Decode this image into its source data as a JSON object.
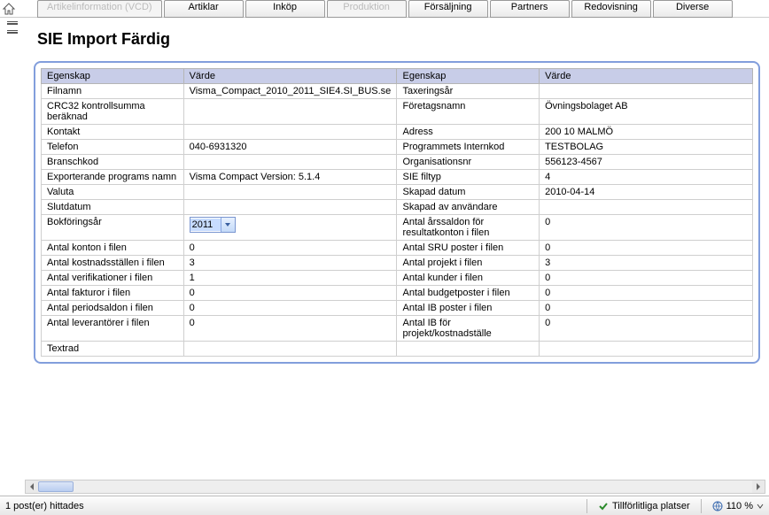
{
  "tabs": {
    "items": [
      {
        "label": "Artikelinformation (VCD)",
        "disabled": true
      },
      {
        "label": "Artiklar",
        "disabled": false
      },
      {
        "label": "Inköp",
        "disabled": false
      },
      {
        "label": "Produktion",
        "disabled": true
      },
      {
        "label": "Försäljning",
        "disabled": false
      },
      {
        "label": "Partners",
        "disabled": false
      },
      {
        "label": "Redovisning",
        "disabled": false
      },
      {
        "label": "Diverse",
        "disabled": false
      }
    ]
  },
  "page": {
    "title": "SIE Import Färdig"
  },
  "table": {
    "headers": [
      "Egenskap",
      "Värde",
      "Egenskap",
      "Värde"
    ],
    "rows": [
      {
        "k1": "Filnamn",
        "v1": "Visma_Compact_2010_2011_SIE4.SI_BUS.se",
        "k2": "Taxeringsår",
        "v2": ""
      },
      {
        "k1": "CRC32 kontrollsumma beräknad",
        "v1": "",
        "k2": "Företagsnamn",
        "v2": "Övningsbolaget AB"
      },
      {
        "k1": "Kontakt",
        "v1": "",
        "k2": "Adress",
        "v2": " 200 10 MALMÖ"
      },
      {
        "k1": "Telefon",
        "v1": "040-6931320",
        "k2": "Programmets Internkod",
        "v2": "TESTBOLAG"
      },
      {
        "k1": "Branschkod",
        "v1": "",
        "k2": "Organisationsnr",
        "v2": "556123-4567"
      },
      {
        "k1": "Exporterande programs namn",
        "v1": "Visma Compact Version: 5.1.4",
        "k2": "SIE filtyp",
        "v2": "4"
      },
      {
        "k1": "Valuta",
        "v1": "",
        "k2": "Skapad datum",
        "v2": "2010-04-14"
      },
      {
        "k1": "Slutdatum",
        "v1": "",
        "k2": "Skapad av användare",
        "v2": ""
      },
      {
        "k1": "Bokföringsår",
        "v1_combo": "2011",
        "k2": "Antal årssaldon för resultatkonton i filen",
        "v2": "0"
      },
      {
        "k1": "Antal konton i filen",
        "v1": "0",
        "k2": "Antal SRU poster i filen",
        "v2": "0"
      },
      {
        "k1": "Antal kostnadsställen i filen",
        "v1": "3",
        "k2": "Antal projekt i filen",
        "v2": "3"
      },
      {
        "k1": "Antal verifikationer i filen",
        "v1": "1",
        "k2": "Antal kunder i filen",
        "v2": "0"
      },
      {
        "k1": "Antal fakturor i filen",
        "v1": "0",
        "k2": "Antal budgetposter i filen",
        "v2": "0"
      },
      {
        "k1": "Antal periodsaldon i filen",
        "v1": "0",
        "k2": "Antal IB poster i filen",
        "v2": "0"
      },
      {
        "k1": "Antal leverantörer i filen",
        "v1": "0",
        "k2": "Antal IB för projekt/kostnadställe",
        "v2": "0"
      },
      {
        "k1": "Textrad",
        "v1": "",
        "k2": "",
        "v2": ""
      }
    ]
  },
  "status": {
    "left": "1 post(er) hittades",
    "trust": "Tillförlitliga platser",
    "zoom": "110 %"
  }
}
